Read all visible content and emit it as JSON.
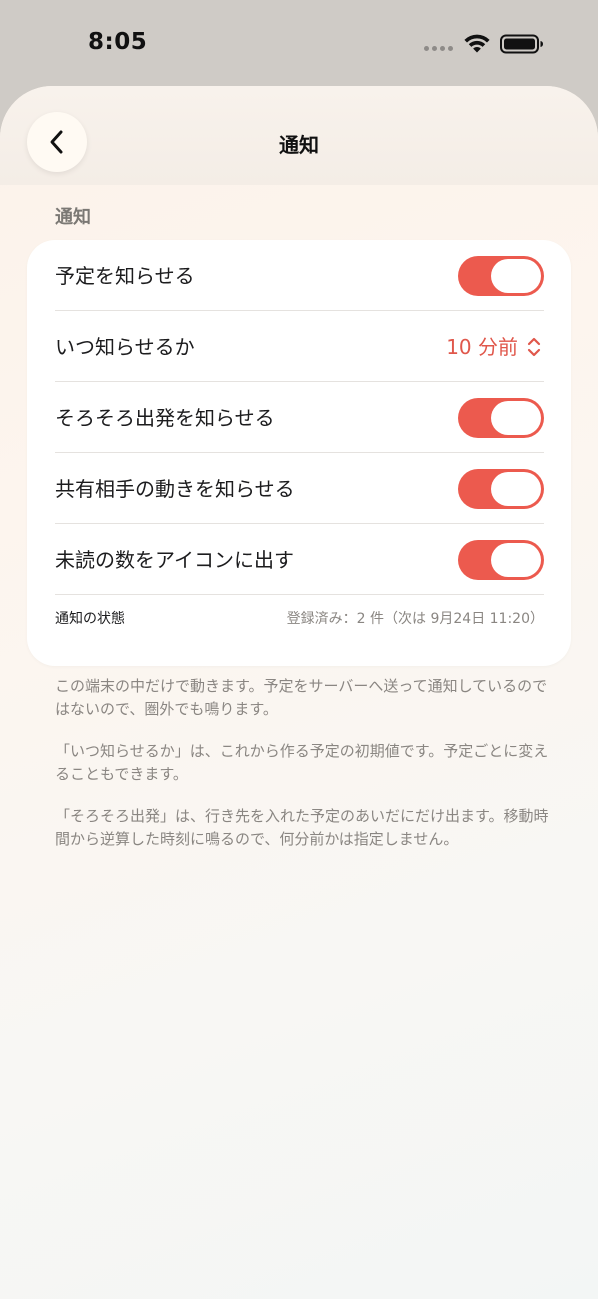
{
  "status_bar": {
    "time": "8:05"
  },
  "nav": {
    "title": "通知"
  },
  "section": {
    "header": "通知"
  },
  "settings": {
    "rows": [
      {
        "label": "予定を知らせる",
        "toggle_on": true
      },
      {
        "label": "いつ知らせるか",
        "value": "10 分前"
      },
      {
        "label": "そろそろ出発を知らせる",
        "toggle_on": true
      },
      {
        "label": "共有相手の動きを知らせる",
        "toggle_on": true
      },
      {
        "label": "未読の数をアイコンに出す",
        "toggle_on": true
      }
    ],
    "status_label": "通知の状態",
    "status_value": "登録済み：2 件（次は 9月24日 11:20）"
  },
  "footnotes": [
    "この端末の中だけで動きます。予定をサーバーへ送って通知しているのではないので、圏外でも鳴ります。",
    "「いつ知らせるか」は、これから作る予定の初期値です。予定ごとに変えることもできます。",
    "「そろそろ出発」は、行き先を入れた予定のあいだにだけ出ます。移動時間から逆算した時刻に鳴るので、何分前かは指定しません。"
  ],
  "colors": {
    "accent": "#ec5a4e",
    "accent_text": "#e0574b"
  },
  "icons": {
    "back": "chevron-left-icon",
    "stepper": "chevron-updown-icon",
    "wifi": "wifi-icon",
    "battery": "battery-icon"
  }
}
